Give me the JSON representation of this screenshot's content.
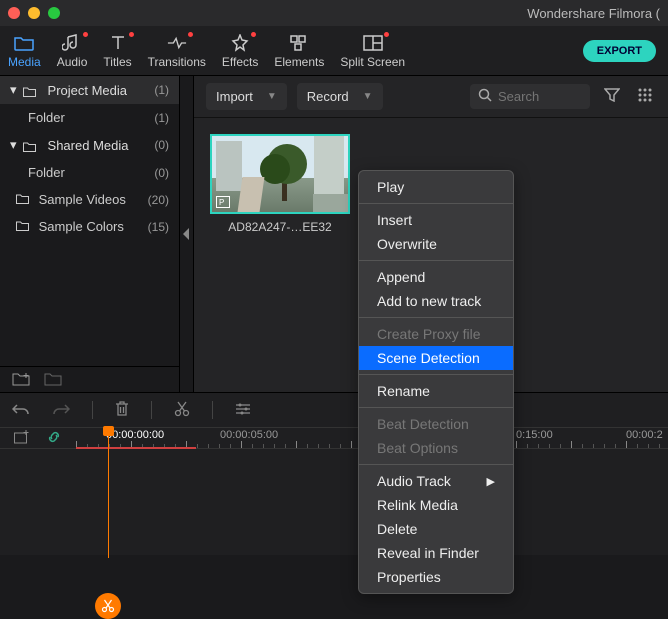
{
  "app": {
    "title": "Wondershare Filmora ("
  },
  "toolbar": {
    "items": [
      {
        "label": "Media",
        "icon": "folder"
      },
      {
        "label": "Audio",
        "icon": "audio"
      },
      {
        "label": "Titles",
        "icon": "titles"
      },
      {
        "label": "Transitions",
        "icon": "transitions"
      },
      {
        "label": "Effects",
        "icon": "effects"
      },
      {
        "label": "Elements",
        "icon": "elements"
      },
      {
        "label": "Split Screen",
        "icon": "split"
      }
    ],
    "export_label": "EXPORT"
  },
  "sidebar": {
    "sections": [
      {
        "label": "Project Media",
        "count": "(1)",
        "children": [
          {
            "label": "Folder",
            "count": "(1)"
          }
        ]
      },
      {
        "label": "Shared Media",
        "count": "(0)",
        "children": [
          {
            "label": "Folder",
            "count": "(0)"
          }
        ]
      },
      {
        "label": "Sample Videos",
        "count": "(20)"
      },
      {
        "label": "Sample Colors",
        "count": "(15)"
      }
    ]
  },
  "contentbar": {
    "import_label": "Import",
    "record_label": "Record",
    "search_placeholder": "Search"
  },
  "gallery": {
    "clips": [
      {
        "label": "AD82A247-…EE32"
      }
    ]
  },
  "context_menu": {
    "items": [
      {
        "label": "Play",
        "type": "item"
      },
      {
        "type": "sep"
      },
      {
        "label": "Insert",
        "type": "item"
      },
      {
        "label": "Overwrite",
        "type": "item"
      },
      {
        "type": "sep"
      },
      {
        "label": "Append",
        "type": "item"
      },
      {
        "label": "Add to new track",
        "type": "item"
      },
      {
        "type": "sep"
      },
      {
        "label": "Create Proxy file",
        "type": "item",
        "disabled": true
      },
      {
        "label": "Scene Detection",
        "type": "item",
        "highlighted": true
      },
      {
        "type": "sep"
      },
      {
        "label": "Rename",
        "type": "item"
      },
      {
        "type": "sep"
      },
      {
        "label": "Beat Detection",
        "type": "item",
        "disabled": true
      },
      {
        "label": "Beat Options",
        "type": "item",
        "disabled": true
      },
      {
        "type": "sep"
      },
      {
        "label": "Audio Track",
        "type": "item",
        "submenu": true
      },
      {
        "label": "Relink Media",
        "type": "item"
      },
      {
        "label": "Delete",
        "type": "item"
      },
      {
        "label": "Reveal in Finder",
        "type": "item"
      },
      {
        "label": "Properties",
        "type": "item"
      }
    ]
  },
  "timeline": {
    "stamps": [
      {
        "text": "00:00:00:00",
        "pos": 106,
        "playhead": true
      },
      {
        "text": "00:00:05:00",
        "pos": 220
      },
      {
        "text": "0:15:00",
        "pos": 516
      },
      {
        "text": "00:00:2",
        "pos": 626
      }
    ]
  }
}
